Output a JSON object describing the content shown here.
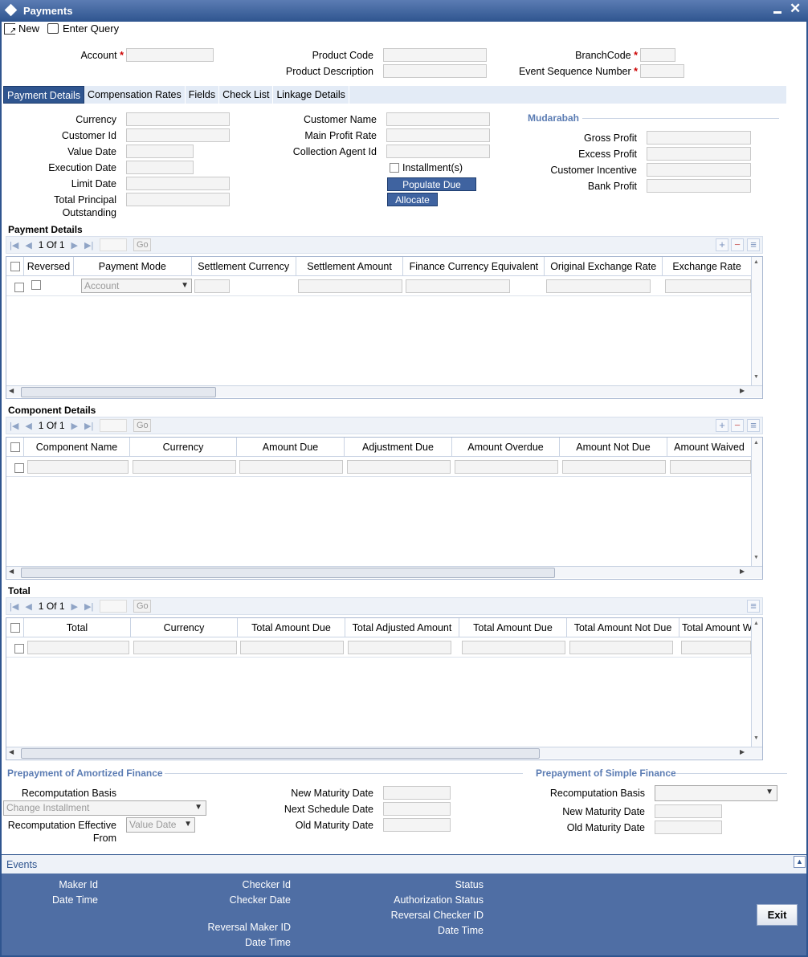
{
  "window": {
    "title": "Payments"
  },
  "toolbar": {
    "new_label": "New",
    "enter_query_label": "Enter Query"
  },
  "header": {
    "account_label": "Account",
    "product_code_label": "Product Code",
    "product_description_label": "Product Description",
    "branch_code_label": "BranchCode",
    "event_sequence_label": "Event Sequence Number",
    "required_mark": "*"
  },
  "tabs": [
    {
      "label": "Payment Details"
    },
    {
      "label": "Compensation Rates"
    },
    {
      "label": "Fields"
    },
    {
      "label": "Check List"
    },
    {
      "label": "Linkage Details"
    }
  ],
  "details": {
    "currency": "Currency",
    "customer_id": "Customer Id",
    "value_date": "Value Date",
    "execution_date": "Execution Date",
    "limit_date": "Limit Date",
    "total_principal_1": "Total Principal",
    "total_principal_2": "Outstanding",
    "customer_name": "Customer Name",
    "main_profit_rate": "Main Profit Rate",
    "collection_agent_id": "Collection Agent Id",
    "installments": "Installment(s)",
    "populate_due": "Populate Due",
    "allocate": "Allocate"
  },
  "mudarabah": {
    "title": "Mudarabah",
    "gross_profit": "Gross Profit",
    "excess_profit": "Excess Profit",
    "customer_incentive": "Customer Incentive",
    "bank_profit": "Bank Profit"
  },
  "pager": {
    "page": "1",
    "of": "Of",
    "total": "1",
    "go": "Go"
  },
  "payment_grid": {
    "title": "Payment Details",
    "columns": [
      "Reversed",
      "Payment Mode",
      "Settlement Currency",
      "Settlement Amount",
      "Finance Currency Equivalent",
      "Original Exchange Rate",
      "Exchange Rate"
    ],
    "row_mode": "Account"
  },
  "component_grid": {
    "title": "Component Details",
    "columns": [
      "Component Name",
      "Currency",
      "Amount Due",
      "Adjustment Due",
      "Amount Overdue",
      "Amount Not Due",
      "Amount Waived"
    ]
  },
  "total_grid": {
    "title": "Total",
    "columns": [
      "Total",
      "Currency",
      "Total Amount Due",
      "Total Adjusted Amount",
      "Total Amount Due",
      "Total Amount Not Due",
      "Total Amount W"
    ]
  },
  "prepay_amortized": {
    "title": "Prepayment of Amortized Finance",
    "recomputation_basis": "Recomputation Basis",
    "recomputation_basis_value": "Change Installment",
    "recomp_effective_1": "Recomputation Effective",
    "recomp_effective_2": "From",
    "recomp_effective_value": "Value Date",
    "new_maturity_date": "New Maturity Date",
    "next_schedule_date": "Next Schedule Date",
    "old_maturity_date": "Old Maturity Date"
  },
  "prepay_simple": {
    "title": "Prepayment of Simple Finance",
    "recomputation_basis": "Recomputation Basis",
    "new_maturity_date": "New Maturity Date",
    "old_maturity_date": "Old Maturity Date"
  },
  "events": {
    "label": "Events"
  },
  "footer": {
    "maker_id": "Maker Id",
    "date_time": "Date Time",
    "checker_id": "Checker Id",
    "checker_date": "Checker Date",
    "reversal_maker_id": "Reversal Maker ID",
    "reversal_date_time": "Date Time",
    "status": "Status",
    "authorization_status": "Authorization Status",
    "reversal_checker_id": "Reversal Checker ID",
    "reversal_checker_date_time": "Date Time",
    "exit": "Exit"
  },
  "colors": {
    "titlebar": "#2f558f",
    "accent": "#3f63a0",
    "footer": "#4f6ea4",
    "required": "#cc0000"
  }
}
